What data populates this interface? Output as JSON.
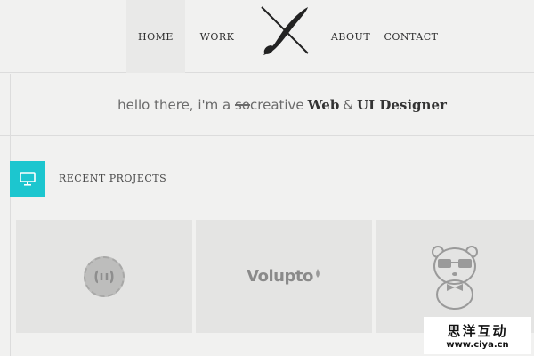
{
  "nav": {
    "items": [
      {
        "label": "HOME"
      },
      {
        "label": "WORK"
      },
      {
        "label": "ABOUT"
      },
      {
        "label": "CONTACT"
      }
    ],
    "logo": "brush-pencil-logo"
  },
  "hero": {
    "intro": "hello there, i'm a",
    "struck": "so",
    "adjective": "creative",
    "role_1": "Web",
    "amp": "&",
    "role_2": "UI Designer"
  },
  "section": {
    "icon": "monitor-icon",
    "title": "RECENT PROJECTS",
    "accent": "#1cc6cf"
  },
  "projects": [
    {
      "icon": "badge-logo"
    },
    {
      "logo_text": "Volupto"
    },
    {
      "icon": "panda-logo"
    }
  ],
  "watermark": {
    "title": "思洋互动",
    "url": "www.ciya.cn"
  }
}
